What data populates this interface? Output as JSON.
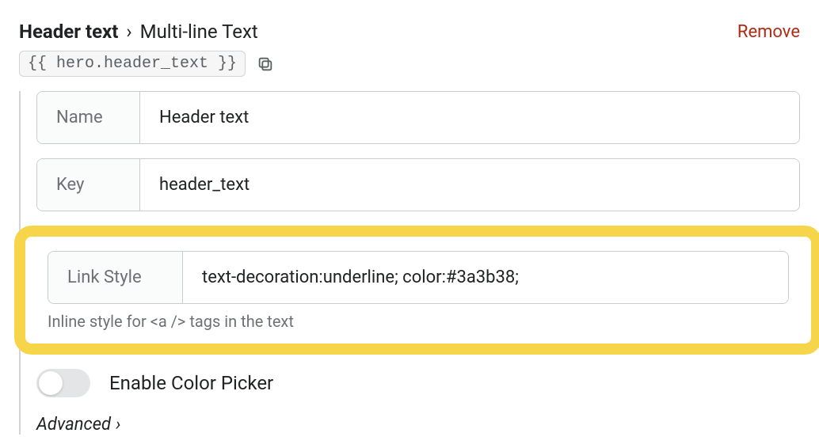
{
  "header": {
    "title": "Header text",
    "separator": "›",
    "type": "Multi-line Text",
    "remove": "Remove"
  },
  "snippet": {
    "code": "{{ hero.header_text }}"
  },
  "fields": {
    "name_label": "Name",
    "name_value": "Header text",
    "key_label": "Key",
    "key_value": "header_text",
    "linkstyle_label": "Link Style",
    "linkstyle_value": "text-decoration:underline; color:#3a3b38;",
    "linkstyle_help": "Inline style for <a /> tags in the text"
  },
  "toggle": {
    "enabled": false,
    "label": "Enable Color Picker"
  },
  "advanced": {
    "label": "Advanced",
    "chevron": "›"
  }
}
